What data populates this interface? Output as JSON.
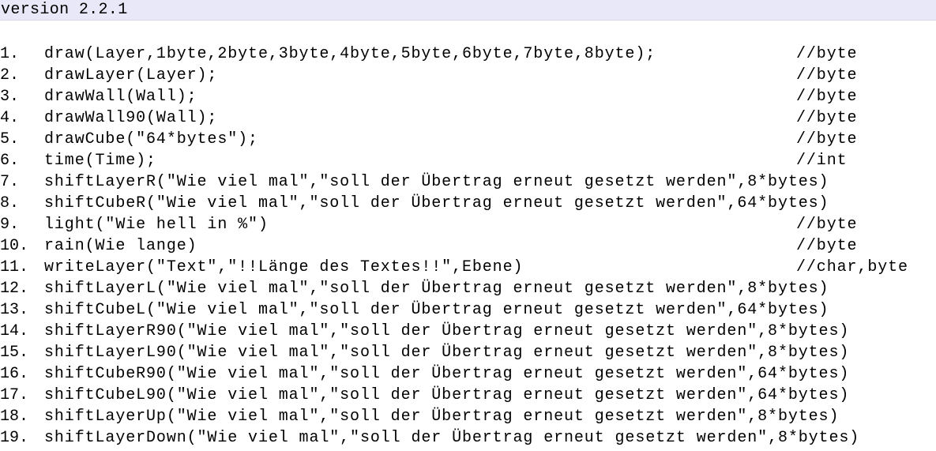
{
  "version_label": "version 2.2.1",
  "lines": [
    {
      "num": "1.",
      "code": "draw(Layer,1byte,2byte,3byte,4byte,5byte,6byte,7byte,8byte);",
      "comment": "//byte"
    },
    {
      "num": "2.",
      "code": "drawLayer(Layer);",
      "comment": "//byte"
    },
    {
      "num": "3.",
      "code": "drawWall(Wall);",
      "comment": "//byte"
    },
    {
      "num": "4.",
      "code": "drawWall90(Wall);",
      "comment": "//byte"
    },
    {
      "num": "5.",
      "code": "drawCube(\"64*bytes\");",
      "comment": "//byte"
    },
    {
      "num": "6.",
      "code": "time(Time);",
      "comment": "//int"
    },
    {
      "num": "7.",
      "code": "shiftLayerR(\"Wie viel mal\",\"soll der Übertrag erneut gesetzt werden\",8*bytes)",
      "comment": ""
    },
    {
      "num": "8.",
      "code": "shiftCubeR(\"Wie viel mal\",\"soll der Übertrag erneut gesetzt werden\",64*bytes)",
      "comment": ""
    },
    {
      "num": "9.",
      "code": "light(\"Wie hell in %\")",
      "comment": "//byte"
    },
    {
      "num": "10.",
      "code": "rain(Wie lange)",
      "comment": "//byte"
    },
    {
      "num": "11.",
      "code": "writeLayer(\"Text\",\"!!Länge des Textes!!\",Ebene)",
      "comment": "//char,byte"
    },
    {
      "num": "12.",
      "code": "shiftLayerL(\"Wie viel mal\",\"soll der Übertrag erneut gesetzt werden\",8*bytes)",
      "comment": ""
    },
    {
      "num": "13.",
      "code": "shiftCubeL(\"Wie viel mal\",\"soll der Übertrag erneut gesetzt werden\",64*bytes)",
      "comment": ""
    },
    {
      "num": "14.",
      "code": "shiftLayerR90(\"Wie viel mal\",\"soll der Übertrag erneut gesetzt werden\",8*bytes)",
      "comment": ""
    },
    {
      "num": "15.",
      "code": "shiftLayerL90(\"Wie viel mal\",\"soll der Übertrag erneut gesetzt werden\",8*bytes)",
      "comment": ""
    },
    {
      "num": "16.",
      "code": "shiftCubeR90(\"Wie viel mal\",\"soll der Übertrag erneut gesetzt werden\",64*bytes)",
      "comment": ""
    },
    {
      "num": "17.",
      "code": "shiftCubeL90(\"Wie viel mal\",\"soll der Übertrag erneut gesetzt werden\",64*bytes)",
      "comment": ""
    },
    {
      "num": "18.",
      "code": "shiftLayerUp(\"Wie viel mal\",\"soll der Übertrag erneut gesetzt werden\",8*bytes)",
      "comment": ""
    },
    {
      "num": "19.",
      "code": "shiftLayerDown(\"Wie viel mal\",\"soll der Übertrag erneut gesetzt werden\",8*bytes)",
      "comment": ""
    }
  ]
}
